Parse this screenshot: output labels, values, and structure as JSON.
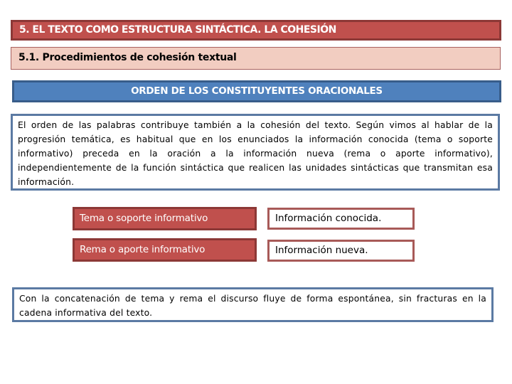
{
  "header": {
    "title": "5. EL TEXTO COMO ESTRUCTURA SINTÁCTICA. LA COHESIÓN",
    "subtitle": "5.1. Procedimientos de cohesión textual"
  },
  "section": {
    "heading": "ORDEN DE LOS CONSTITUYENTES ORACIONALES"
  },
  "body": {
    "paragraph": "El orden de las palabras contribuye también a la cohesión del texto. Según vimos al hablar de la progresión temática, es habitual que en los enunciados la información conocida (tema o soporte informativo) preceda en la oración a la información nueva (rema o aporte informativo), independientemente de la función sintáctica que realicen las unidades sintácticas que transmitan esa información."
  },
  "table": {
    "rows": [
      {
        "term": "Tema o soporte informativo",
        "definition": "Información conocida."
      },
      {
        "term": "Rema o aporte informativo",
        "definition": "Información nueva."
      }
    ]
  },
  "closing": {
    "paragraph": "Con la concatenación de tema y rema el discurso fluye de forma espontánea, sin fracturas en la cadena informativa del texto."
  },
  "colors": {
    "title_bg": "#c0504d",
    "subtitle_bg": "#f2cdc1",
    "section_bg": "#4f81bd",
    "box_border": "#5b7aa3"
  }
}
